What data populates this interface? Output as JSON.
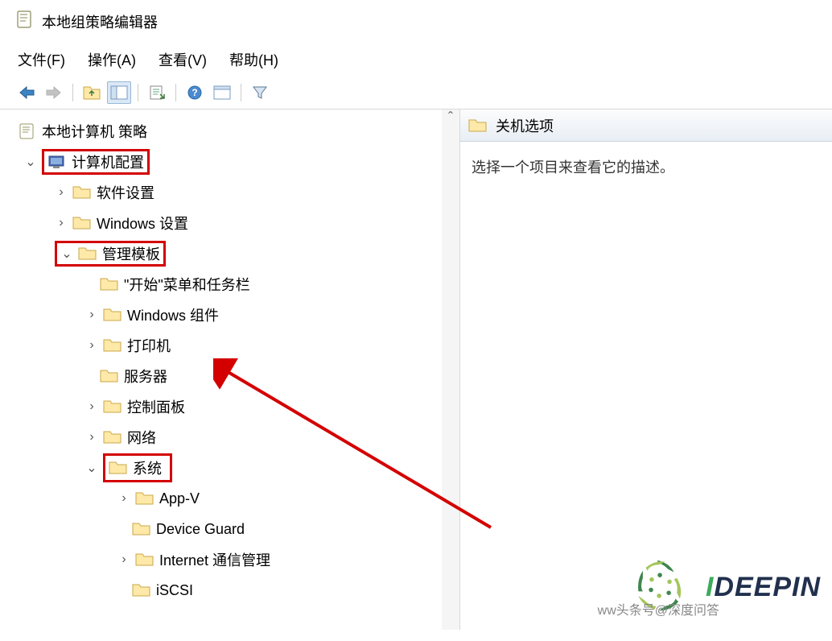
{
  "window": {
    "title": "本地组策略编辑器"
  },
  "menu": {
    "file": "文件(F)",
    "action": "操作(A)",
    "view": "查看(V)",
    "help": "帮助(H)"
  },
  "tree": {
    "root": "本地计算机 策略",
    "computer_config": "计算机配置",
    "software_settings": "软件设置",
    "windows_settings": "Windows 设置",
    "admin_templates": "管理模板",
    "start_menu": "\"开始\"菜单和任务栏",
    "windows_components": "Windows 组件",
    "printers": "打印机",
    "server": "服务器",
    "control_panel": "控制面板",
    "network": "网络",
    "system": "系统",
    "appv": "App-V",
    "device_guard": "Device Guard",
    "internet_comm": "Internet 通信管理",
    "iscsi": "iSCSI"
  },
  "right": {
    "header": "关机选项",
    "body": "选择一个项目来查看它的描述。"
  },
  "watermark": {
    "brand_i": "I",
    "brand_rest": "DEEPIN",
    "url_prefix": "ww",
    "credit": "头条号@深度问答",
    "sub": "度问答"
  }
}
